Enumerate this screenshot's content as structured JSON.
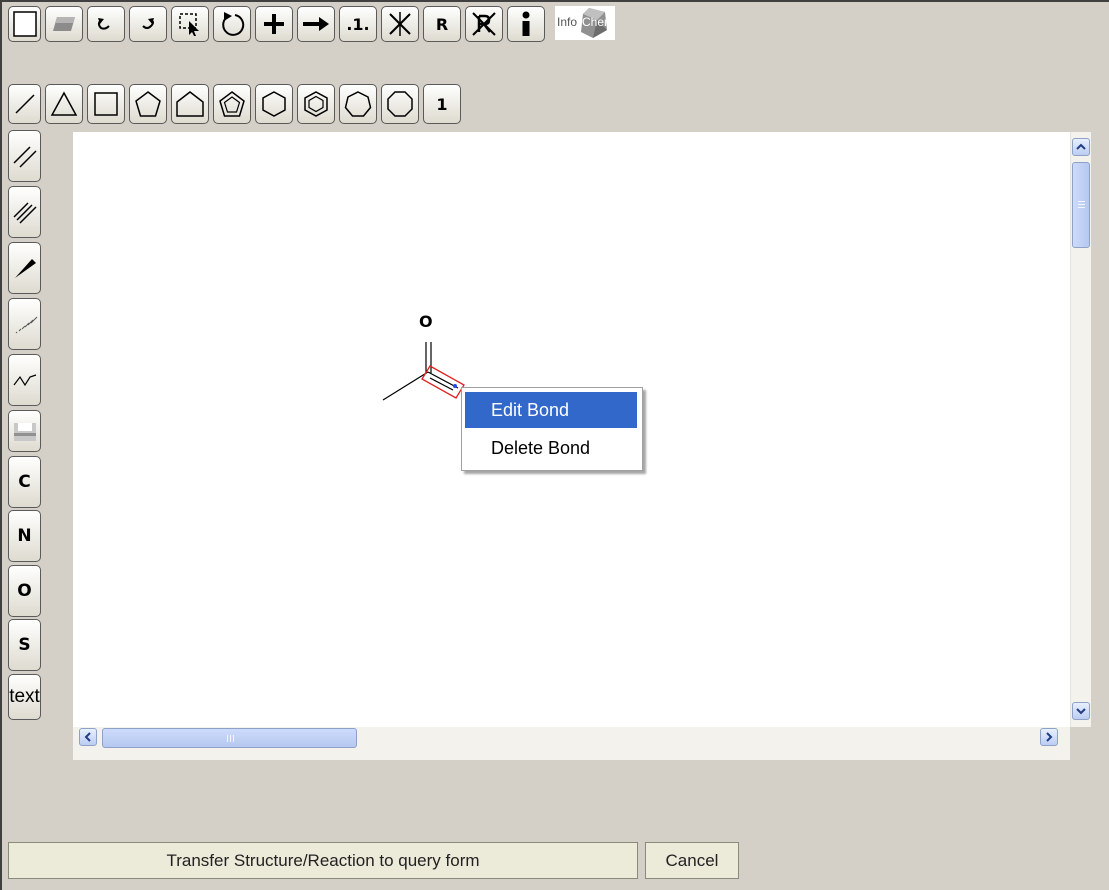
{
  "toolbar": {
    "charge_label": ".1.",
    "rgroup_label": "R",
    "logo_text_1": "Info",
    "logo_text_2": "Chem",
    "atom_number_label": "1"
  },
  "left_toolbar": {
    "carbon_label": "C",
    "nitrogen_label": "N",
    "oxygen_label": "O",
    "sulfur_label": "S",
    "text_label": "text"
  },
  "molecule": {
    "atom_label": "O"
  },
  "context_menu": {
    "items": [
      "Edit Bond",
      "Delete Bond"
    ],
    "selected_index": 0
  },
  "footer": {
    "transfer_label": "Transfer Structure/Reaction to query form",
    "cancel_label": "Cancel"
  },
  "colors": {
    "toolbar_bg": "#d4d0c8",
    "menu_highlight": "#3168c9",
    "bond_selection": "#e02020"
  }
}
